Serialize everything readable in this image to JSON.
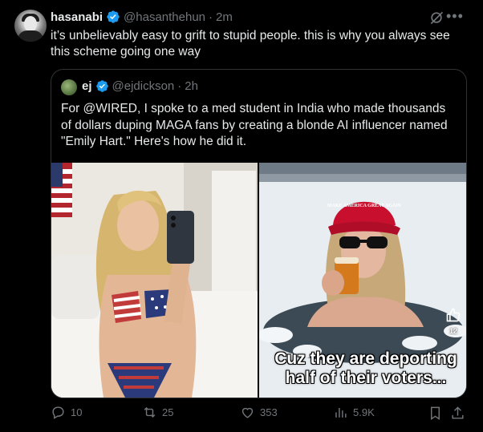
{
  "post": {
    "author_name": "hasanabi",
    "author_handle": "@hasanthehun",
    "separator": "·",
    "time": "2m",
    "text": "it’s unbelievably easy to grift to stupid people. this is why you always see this scheme going one way"
  },
  "quote": {
    "author_name": "ej",
    "author_handle": "@ejdickson",
    "separator": "·",
    "time": "2h",
    "text": "For @WIRED, I spoke to a med student in India who made thousands of dollars duping MAGA fans by creating a blonde AI influencer named \"Emily Hart.\" Here's how he did it.",
    "images": {
      "right_caption": "Cuz they are deporting half of their voters...",
      "hat_text": "MAKE AMERICA GREAT AGAIN",
      "like_count": "12"
    }
  },
  "actions": {
    "replies": "10",
    "reposts": "25",
    "likes": "353",
    "views": "5.9K"
  },
  "colors": {
    "background": "#000000",
    "text": "#e7e9ea",
    "muted": "#71767b",
    "verified": "#1d9bf0",
    "border": "#2f3336"
  }
}
